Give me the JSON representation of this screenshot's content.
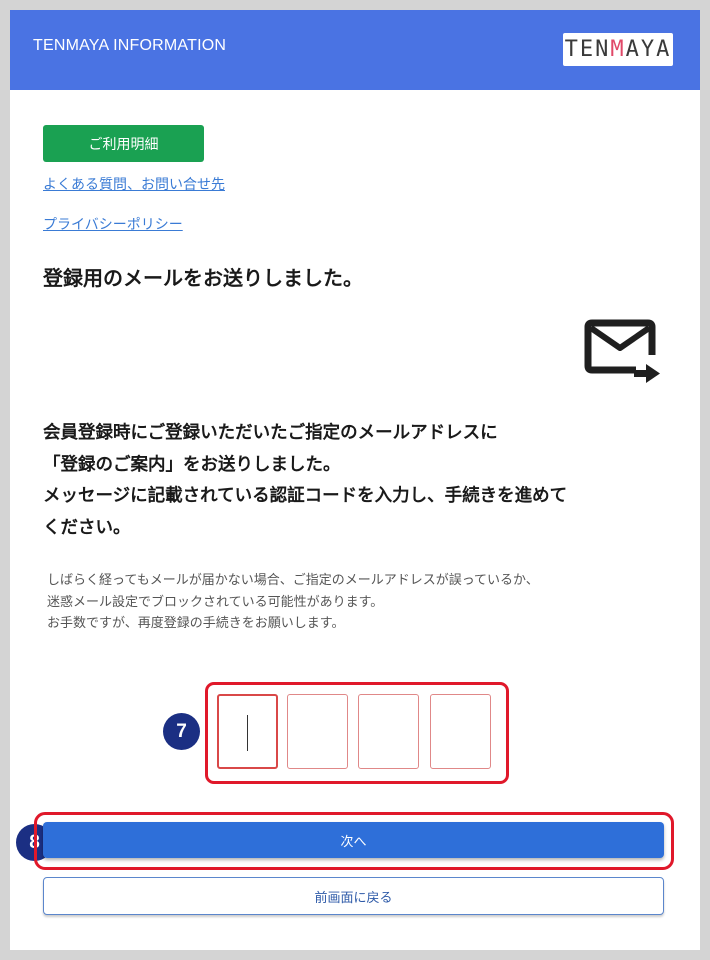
{
  "header": {
    "title": "TENMAYA INFORMATION",
    "logo_text_a": "TEN",
    "logo_text_b": "M",
    "logo_text_c": "AYA"
  },
  "nav": {
    "usage_button": "ご利用明細",
    "faq_link": "よくある質問、お問い合せ先",
    "privacy_link": "プライバシーポリシー"
  },
  "main": {
    "heading": "登録用のメールをお送りしました。",
    "mail_icon": "mail-forward-icon",
    "lead_lines": [
      "会員登録時にご登録いただいたご指定のメールアドレスに",
      "「登録のご案内」をお送りしました。",
      "メッセージに記載されている認証コードを入力し、手続きを進めて",
      "ください。"
    ],
    "note_lines": [
      "しばらく経ってもメールが届かない場合、ご指定のメールアドレスが誤っているか、",
      "迷惑メール設定でブロックされている可能性があります。",
      "お手数ですが、再度登録の手続きをお願いします。"
    ]
  },
  "code_input": {
    "digits": [
      "",
      "",
      "",
      ""
    ],
    "step_badge": "7"
  },
  "actions": {
    "next_label": "次へ",
    "next_badge": "8",
    "back_label": "前画面に戻る"
  },
  "colors": {
    "header_bg": "#4a73e3",
    "green_button": "#1aa152",
    "primary_button": "#2e6fd9",
    "highlight": "#e0182a",
    "badge": "#1b2f83",
    "link": "#3a7bd5"
  }
}
